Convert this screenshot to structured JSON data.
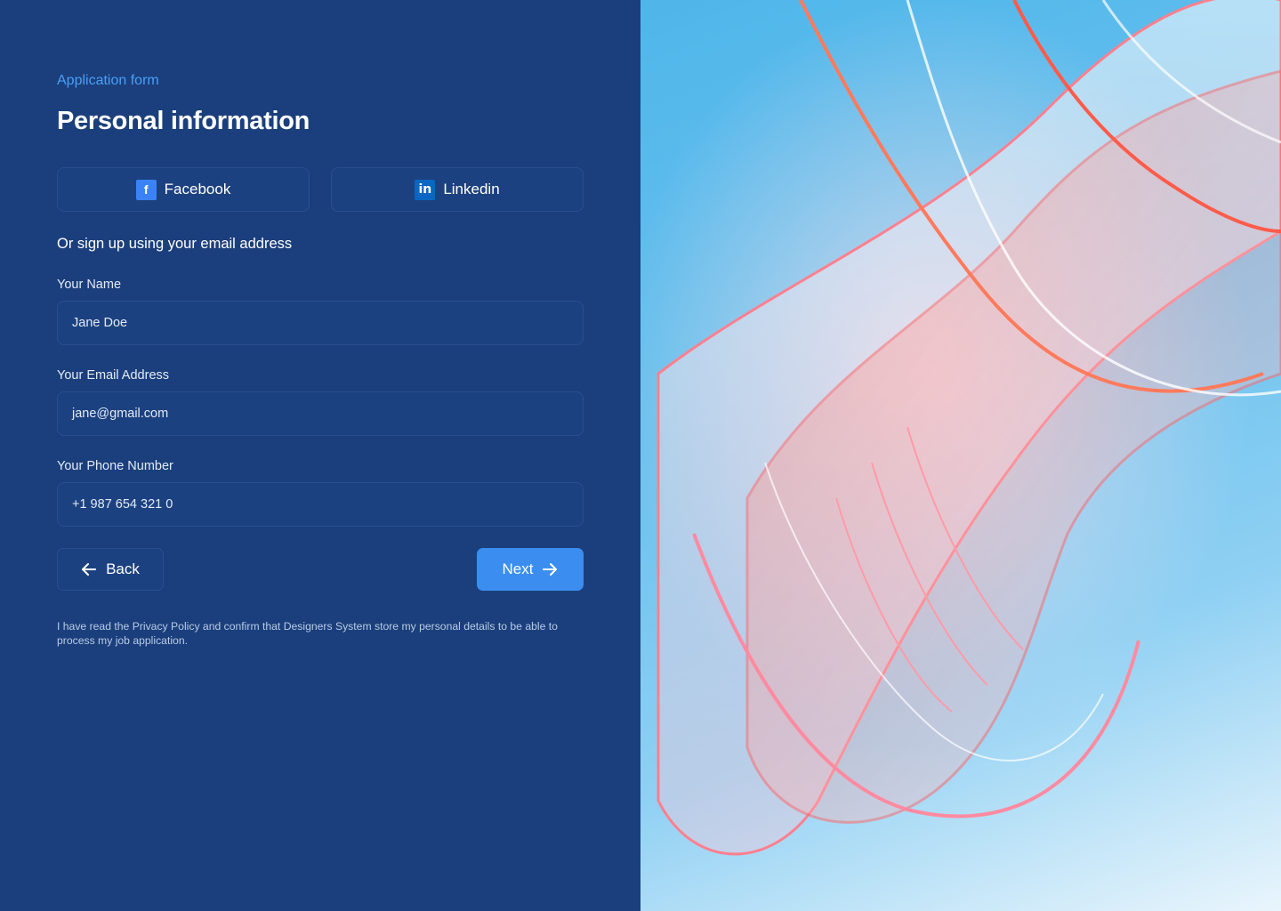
{
  "form": {
    "eyebrow": "Application form",
    "title": "Personal information",
    "social": {
      "facebook": {
        "label": "Facebook",
        "icon": "facebook-icon"
      },
      "linkedin": {
        "label": "Linkedin",
        "icon": "linkedin-icon"
      }
    },
    "alt_signup": "Or sign up using your email address",
    "fields": {
      "name": {
        "label": "Your Name",
        "value": "Jane Doe"
      },
      "email": {
        "label": "Your Email Address",
        "value": "jane@gmail.com"
      },
      "phone": {
        "label": "Your Phone Number",
        "value": "+1 987 654 321 0"
      }
    },
    "back_label": "Back",
    "next_label": "Next",
    "disclaimer": "I have read the Privacy Policy and confirm that Designers System store my personal details to be able to process my job application."
  },
  "colors": {
    "panel_bg": "#1b3f7c",
    "accent": "#3b8ef0",
    "eyebrow": "#4a9ff5"
  }
}
